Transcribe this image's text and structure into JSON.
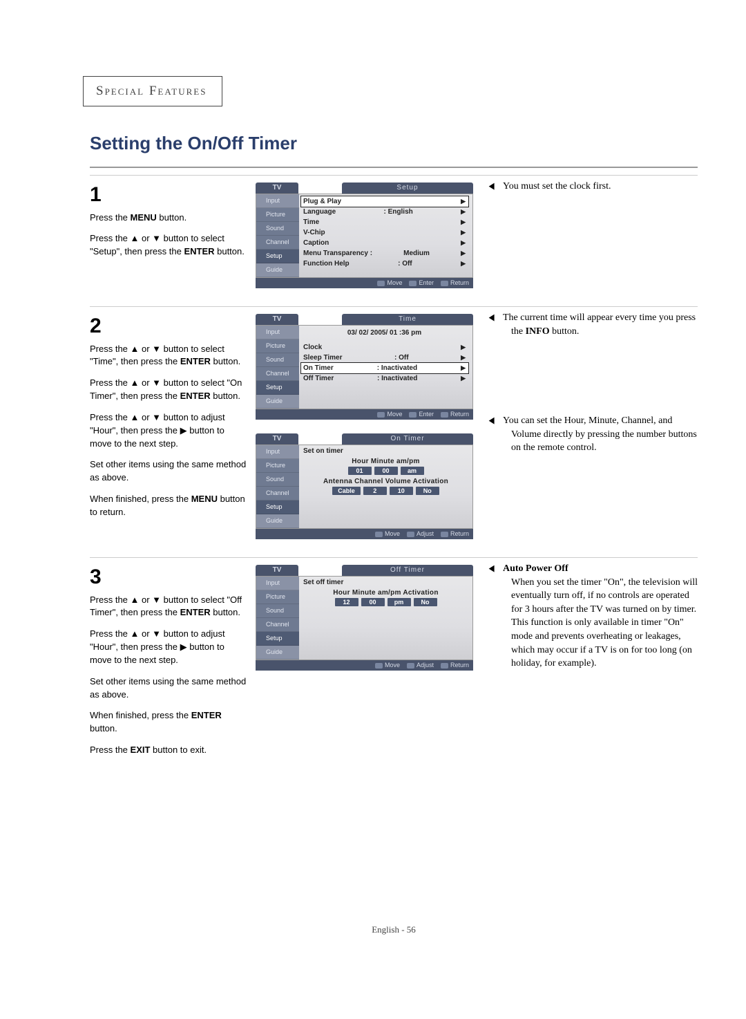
{
  "header": "Special Features",
  "title": "Setting the On/Off Timer",
  "page_footer": "English - 56",
  "osd_common": {
    "tv": "TV",
    "side": [
      "Input",
      "Picture",
      "Sound",
      "Channel",
      "Setup",
      "Guide"
    ]
  },
  "step1": {
    "num": "1",
    "p1a": "Press the ",
    "p1b": "MENU",
    "p1c": " button.",
    "p2": "Press the ▲ or ▼ button to select \"Setup\", then press the ",
    "p2b": "ENTER",
    "p2c": " button.",
    "right": "You must set the clock first.",
    "osd": {
      "tab": "Setup",
      "rows": [
        {
          "l": "Plug & Play",
          "r": "",
          "sel": true
        },
        {
          "l": "Language",
          "r": ":  English"
        },
        {
          "l": "Time",
          "r": ""
        },
        {
          "l": "V-Chip",
          "r": ""
        },
        {
          "l": "Caption",
          "r": ""
        },
        {
          "l": "Menu Transparency :",
          "r": "Medium"
        },
        {
          "l": "Function Help",
          "r": ":  Off"
        }
      ],
      "footer": [
        "Move",
        "Enter",
        "Return"
      ]
    }
  },
  "step2": {
    "num": "2",
    "p1": "Press the  ▲ or ▼ button to select \"Time\", then press the ",
    "p1b": "ENTER",
    "p1c": " button.",
    "p2": "Press the ▲ or ▼ button to select \"On Timer\", then press the ",
    "p2b": "ENTER",
    "p2c": " button.",
    "p3": "Press the ▲ or ▼ button to adjust \"Hour\", then press the ▶ button to move to the next step.",
    "p4": "Set other items using the same method as above.",
    "p5a": "When finished, press the ",
    "p5b": "MENU",
    "p5c": " button to return.",
    "r1a": "The current time will appear every time you press the ",
    "r1b": "INFO",
    "r1c": " button.",
    "r2": "You can set the Hour, Minute, Channel, and Volume directly by pressing the number buttons on the remote control.",
    "osd_time": {
      "tab": "Time",
      "datetime": "03/ 02/ 2005/ 01 :36  pm",
      "rows": [
        {
          "l": "Clock",
          "r": ""
        },
        {
          "l": "Sleep Timer",
          "r": ":   Off"
        },
        {
          "l": "On Timer",
          "r": ":   Inactivated",
          "sel": true
        },
        {
          "l": "Off Timer",
          "r": ":   Inactivated"
        }
      ],
      "footer": [
        "Move",
        "Enter",
        "Return"
      ]
    },
    "osd_on": {
      "tab": "On Timer",
      "title": "Set on timer",
      "h1": "Hour  Minute  am/pm",
      "v1": [
        "01",
        "00",
        "am"
      ],
      "h2": "Antenna Channel  Volume Activation",
      "v2": [
        "Cable",
        "2",
        "10",
        "No"
      ],
      "footer": [
        "Move",
        "Adjust",
        "Return"
      ]
    }
  },
  "step3": {
    "num": "3",
    "p1": "Press the ▲ or ▼ button to select \"Off Timer\", then press the ",
    "p1b": "ENTER",
    "p1c": " button.",
    "p2": "Press the ▲ or ▼ button to adjust \"Hour\", then press the ▶ button to move to the next step.",
    "p3": "Set other items using the same method as above.",
    "p4a": "When finished, press the ",
    "p4b": "ENTER",
    "p4c": " button.",
    "p5a": "Press the ",
    "p5b": "EXIT",
    "p5c": " button to exit.",
    "rt": "Auto Power Off",
    "rb": "When you set the timer \"On\", the television will eventually turn off, if no controls are operated for 3 hours after the TV was turned on by timer. This function is only available in timer \"On\" mode and prevents overheating or leakages, which may occur if a TV is on for too long (on holiday, for example).",
    "osd_off": {
      "tab": "Off Timer",
      "title": "Set off timer",
      "h1": "Hour  Minute  am/pm  Activation",
      "v1": [
        "12",
        "00",
        "pm",
        "No"
      ],
      "footer": [
        "Move",
        "Adjust",
        "Return"
      ]
    }
  }
}
